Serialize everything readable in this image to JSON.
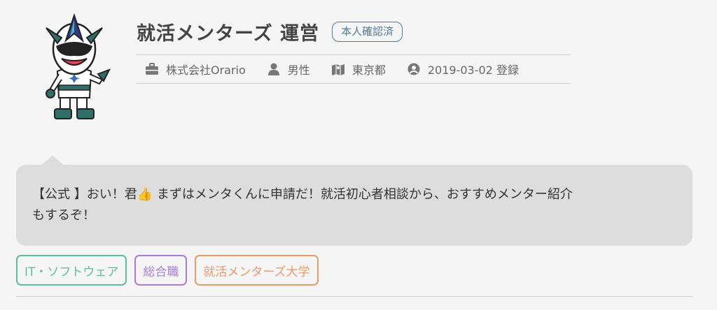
{
  "profile": {
    "name": "就活メンターズ 運営",
    "badge": "本人確認済"
  },
  "meta": {
    "company": "株式会社Orario",
    "gender": "男性",
    "location": "東京都",
    "registered": "2019-03-02 登録"
  },
  "message": {
    "line1": "【公式 】おい！君👍 まずはメンタくんに申請だ！就活初心者相談から、おすすめメンター紹介",
    "line2": "もするぞ！"
  },
  "tags": [
    {
      "label": "IT・ソフトウェア",
      "color": "#5cbf9b"
    },
    {
      "label": "総合職",
      "color": "#a77ddb"
    },
    {
      "label": "就活メンターズ大学",
      "color": "#e99b6c"
    }
  ],
  "icons": {
    "company": "briefcase-icon",
    "gender": "person-icon",
    "location": "map-icon",
    "registered": "user-circle-icon"
  }
}
